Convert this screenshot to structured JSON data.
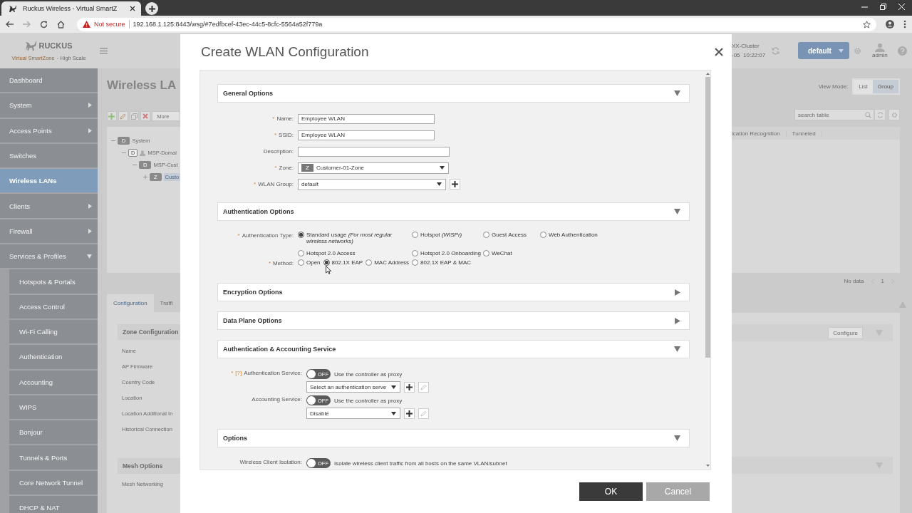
{
  "browser": {
    "tabs": [
      {
        "title": "Ruckus Wireless - Virtual SmartZ",
        "selected": true
      }
    ],
    "security": "Not secure",
    "url": "192.168.1.125:8443/wsg/#7edfbcef-43ec-44c5-8cfc-5564a52f779a"
  },
  "header": {
    "logo": "RUCKUS",
    "product": "Virtual SmartZone",
    "edition": "- High Scale",
    "cluster": "XX-Cluster",
    "timestamp": "-05  10:22:07",
    "domain_button": "default",
    "user": "admin"
  },
  "sidebar": {
    "items": [
      {
        "label": "Dashboard",
        "kind": "page",
        "selected": false
      },
      {
        "label": "System",
        "kind": "menu",
        "expanded": false,
        "selected": false
      },
      {
        "label": "Access Points",
        "kind": "menu",
        "expanded": false,
        "selected": false
      },
      {
        "label": "Switches",
        "kind": "page",
        "selected": false
      },
      {
        "label": "Wireless LANs",
        "kind": "page",
        "selected": true
      },
      {
        "label": "Clients",
        "kind": "menu",
        "expanded": false,
        "selected": false
      },
      {
        "label": "Firewall",
        "kind": "menu",
        "expanded": false,
        "selected": false
      },
      {
        "label": "Services & Profiles",
        "kind": "menu",
        "expanded": true,
        "selected": false,
        "children": [
          {
            "label": "Hotspots & Portals",
            "selected": false
          },
          {
            "label": "Access Control",
            "selected": false
          },
          {
            "label": "Wi-Fi Calling",
            "selected": false
          },
          {
            "label": "Authentication",
            "selected": false
          },
          {
            "label": "Accounting",
            "selected": false
          },
          {
            "label": "WIPS",
            "selected": false
          },
          {
            "label": "Bonjour",
            "selected": false
          },
          {
            "label": "Tunnels & Ports",
            "selected": false
          },
          {
            "label": "Core Network Tunnel",
            "selected": false
          },
          {
            "label": "DHCP & NAT",
            "selected": false
          }
        ]
      }
    ]
  },
  "main": {
    "title": "Wireless LA",
    "toolbar": {
      "more": "More"
    },
    "tree": [
      {
        "badge": "D",
        "label": "System",
        "expanded": true,
        "selected": false,
        "children": [
          {
            "badge": "D",
            "kind": "partner",
            "label": "MSP-Domai",
            "expanded": true,
            "selected": false,
            "children": [
              {
                "badge": "D",
                "label": "MSP-Cust",
                "expanded": true,
                "selected": false,
                "children": [
                  {
                    "badge": "Z",
                    "label": "Custo",
                    "expanded": false,
                    "selected": true
                  }
                ]
              }
            ]
          }
        ]
      }
    ],
    "tabs": [
      {
        "label": "Configuration",
        "selected": true
      },
      {
        "label": "Traffi",
        "selected": false
      }
    ],
    "zone_panel": {
      "title": "Zone Configuration",
      "labels": [
        "Name",
        "AP Firmware",
        "Country Code",
        "Location",
        "Location Additional In",
        "Historical Connection"
      ]
    },
    "mesh_panel": {
      "title": "Mesh Options",
      "labels": [
        "Mesh Networking"
      ]
    },
    "view_mode": {
      "label": "View Mode:",
      "options": [
        {
          "label": "List",
          "selected": false
        },
        {
          "label": "Group",
          "selected": true
        }
      ]
    },
    "search": {
      "placeholder": "search table"
    },
    "table": {
      "columns": [
        "ication Recognition",
        "Tunneled"
      ],
      "empty": "No data",
      "page": "1"
    },
    "configure_button": "Configure"
  },
  "dialog": {
    "title": "Create WLAN Configuration",
    "sections": [
      {
        "title": "General Options",
        "expanded": true,
        "fields": [
          {
            "kind": "text",
            "marker": "*",
            "label": "Name:",
            "value": "Employee WLAN"
          },
          {
            "kind": "text",
            "marker": "*",
            "label": "SSID:",
            "value": "Employee WLAN"
          },
          {
            "kind": "text",
            "label": "Description:"
          },
          {
            "kind": "select",
            "marker": "*",
            "label": "Zone:",
            "badge": "Z",
            "value": "Customer-01-Zone"
          },
          {
            "kind": "select",
            "marker": "*",
            "label": "WLAN Group:",
            "value": "default",
            "actions": [
              {
                "kind": "add",
                "disabled": false
              }
            ]
          }
        ]
      },
      {
        "title": "Authentication Options",
        "expanded": true,
        "fields": [
          {
            "kind": "radio",
            "marker": "*",
            "label": "Authentication Type:",
            "options": [
              {
                "label": "Standard usage *(For most regular wireless networks)*",
                "selected": true
              },
              {
                "label": "Hotspot *(WISPr)*",
                "selected": false
              },
              {
                "label": "Guest Access",
                "selected": false
              },
              {
                "label": "Web Authentication",
                "selected": false
              },
              {
                "label": "Hotspot 2.0 Access",
                "selected": false
              },
              {
                "label": "Hotspot 2.0 Onboarding",
                "selected": false
              },
              {
                "label": "WeChat",
                "selected": false
              }
            ]
          },
          {
            "kind": "radio",
            "marker": "*",
            "label": "Method:",
            "options": [
              {
                "label": "Open",
                "selected": false
              },
              {
                "label": "802.1X EAP",
                "selected": true
              },
              {
                "label": "MAC Address",
                "selected": false
              },
              {
                "label": "802.1X EAP & MAC",
                "selected": false
              }
            ]
          }
        ]
      },
      {
        "title": "Encryption Options",
        "expanded": false
      },
      {
        "title": "Data Plane Options",
        "expanded": false
      },
      {
        "title": "Authentication & Accounting Service",
        "expanded": true,
        "fields": [
          {
            "kind": "toggle",
            "marker": "*",
            "help": "[?]",
            "label": "Authentication Service:",
            "on": false,
            "switch_text": "OFF",
            "text": "Use the controller as proxy",
            "select": {
              "value": "Select an authentication serve",
              "actions": [
                {
                  "kind": "add",
                  "disabled": false
                },
                {
                  "kind": "edit",
                  "disabled": true
                }
              ]
            }
          },
          {
            "kind": "toggle",
            "label": "Accounting Service:",
            "on": false,
            "switch_text": "OFF",
            "text": "Use the controller as proxy",
            "select": {
              "value": "Disable",
              "actions": [
                {
                  "kind": "add",
                  "disabled": false
                },
                {
                  "kind": "edit",
                  "disabled": true
                }
              ]
            }
          }
        ]
      },
      {
        "title": "Options",
        "expanded": true,
        "fields": [
          {
            "kind": "toggle",
            "label": "Wireless Client Isolation:",
            "on": false,
            "switch_text": "OFF",
            "text": "Isolate wireless client traffic from all hosts on the same VLAN/subnet"
          }
        ]
      }
    ],
    "buttons": [
      {
        "label": "OK",
        "kind": "primary"
      },
      {
        "label": "Cancel",
        "kind": "secondary"
      }
    ]
  }
}
